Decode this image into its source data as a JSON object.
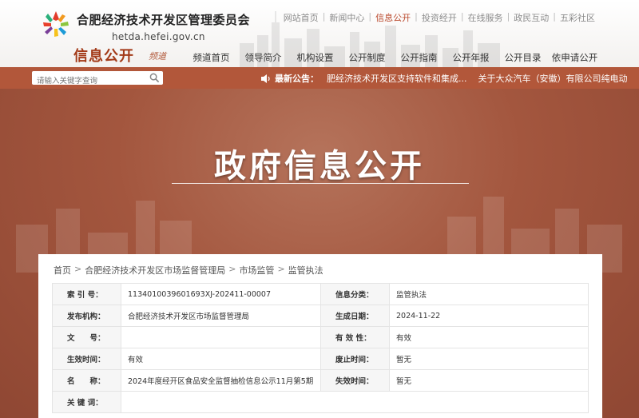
{
  "header": {
    "org_name": "合肥经济技术开发区管理委员会",
    "org_url": "hetda.hefei.gov.cn",
    "channel_title": "信息公开",
    "channel_sub": "频道",
    "top_links": [
      "网站首页",
      "新闻中心",
      "信息公开",
      "投资经开",
      "在线服务",
      "政民互动",
      "五彩社区"
    ],
    "active_top_link": "信息公开",
    "main_nav": [
      "频道首页",
      "领导简介",
      "机构设置",
      "公开制度",
      "公开指南",
      "公开年报",
      "公开目录",
      "依申请公开"
    ]
  },
  "search": {
    "placeholder": "请输入关键字查询",
    "icon": "search-icon"
  },
  "announcement": {
    "label": "最新公告：",
    "items": [
      "肥经济技术开发区支持软件和集成...",
      "关于大众汽车（安徽）有限公司纯电动"
    ],
    "icon": "speaker-icon"
  },
  "banner": {
    "title": "政府信息公开"
  },
  "breadcrumb": [
    "首页",
    "合肥经济技术开发区市场监督管理局",
    "市场监管",
    "监管执法"
  ],
  "info_table": {
    "rows": [
      {
        "l1": "索 引 号：",
        "v1": "1134010039601693XJ-202411-00007",
        "l2": "信息分类：",
        "v2": "监管执法"
      },
      {
        "l1": "发布机构：",
        "v1": "合肥经济技术开发区市场监督管理局",
        "l2": "生成日期：",
        "v2": "2024-11-22"
      },
      {
        "l1": "文　　号：",
        "v1": "",
        "l2": "有 效 性：",
        "v2": "有效"
      },
      {
        "l1": "生效时间：",
        "v1": "有效",
        "l2": "废止时间：",
        "v2": "暂无"
      },
      {
        "l1": "名　　称：",
        "v1": "2024年度经开区食品安全监督抽检信息公示11月第5期",
        "l2": "失效时间：",
        "v2": "暂无"
      },
      {
        "l1": "关 键 词：",
        "v1": "",
        "l2": "",
        "v2": ""
      }
    ]
  },
  "colors": {
    "accent": "#b2573a",
    "channel_title": "#a33a18",
    "active_link": "#b9472a",
    "banner": "#a3563e"
  }
}
